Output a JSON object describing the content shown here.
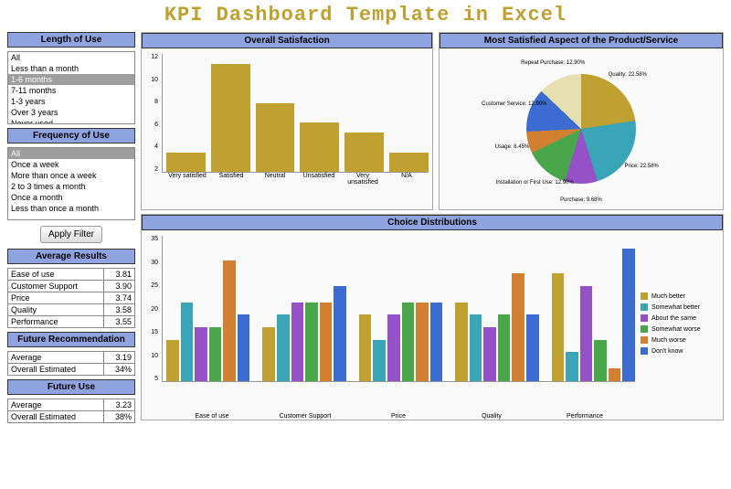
{
  "page_title": "KPI Dashboard Template in Excel",
  "filters": {
    "length_header": "Length of Use",
    "length_items": [
      "All",
      "Less than a month",
      "1-6 months",
      "7-11 months",
      "1-3 years",
      "Over 3 years",
      "Never used"
    ],
    "length_selected": "1-6 months",
    "freq_header": "Frequency of Use",
    "freq_items": [
      "All",
      "Once a week",
      "More than once a week",
      "2 to 3 times a month",
      "Once a month",
      "Less than once a month"
    ],
    "freq_selected": "All",
    "apply_label": "Apply Filter"
  },
  "avg_results": {
    "header": "Average Results",
    "rows": [
      {
        "label": "Ease of use",
        "value": "3.81"
      },
      {
        "label": "Customer Support",
        "value": "3.90"
      },
      {
        "label": "Price",
        "value": "3.74"
      },
      {
        "label": "Quality",
        "value": "3.58"
      },
      {
        "label": "Performance",
        "value": "3.55"
      }
    ]
  },
  "future_rec": {
    "header": "Future Recommendation",
    "rows": [
      {
        "label": "Average",
        "value": "3.19"
      },
      {
        "label": "Overall Estimated",
        "value": "34%"
      }
    ]
  },
  "future_use": {
    "header": "Future Use",
    "rows": [
      {
        "label": "Average",
        "value": "3.23"
      },
      {
        "label": "Overall Estimated",
        "value": "38%"
      }
    ]
  },
  "chart_data": [
    {
      "type": "bar",
      "title": "Overall Satisfaction",
      "categories": [
        "Very satisfied",
        "Satisfied",
        "Neutral",
        "Unsatisfied",
        "Very unsatisfied",
        "N/A"
      ],
      "values": [
        2,
        11,
        7,
        5,
        4,
        2
      ],
      "ylim": [
        0,
        12
      ],
      "yticks": [
        2,
        4,
        6,
        8,
        10,
        12
      ],
      "color": "#c0a030"
    },
    {
      "type": "pie",
      "title": "Most Satisfied Aspect of the Product/Service",
      "slices": [
        {
          "label": "Quality",
          "value": 22.58,
          "color": "#c0a030"
        },
        {
          "label": "Price",
          "value": 22.58,
          "color": "#39a5b7"
        },
        {
          "label": "Purchase",
          "value": 9.68,
          "color": "#9552c7"
        },
        {
          "label": "Installation or First Use",
          "value": 12.9,
          "color": "#4aa64a"
        },
        {
          "label": "Usage",
          "value": 6.45,
          "color": "#d08030"
        },
        {
          "label": "Customer Service",
          "value": 12.9,
          "color": "#3d6cd0"
        },
        {
          "label": "Repeat Purchase",
          "value": 12.9,
          "color": "#e6e0b0"
        }
      ]
    },
    {
      "type": "bar",
      "title": "Choice Distributions",
      "categories": [
        "Ease of use",
        "Customer Support",
        "Price",
        "Quality",
        "Performance"
      ],
      "series": [
        {
          "name": "Much better",
          "color": "#c0a030",
          "values": [
            10,
            13,
            16,
            19,
            26
          ]
        },
        {
          "name": "Somewhat better",
          "color": "#39a5b7",
          "values": [
            19,
            16,
            10,
            16,
            7
          ]
        },
        {
          "name": "About the same",
          "color": "#9552c7",
          "values": [
            13,
            19,
            16,
            13,
            23
          ]
        },
        {
          "name": "Somewhat worse",
          "color": "#4aa64a",
          "values": [
            13,
            19,
            19,
            16,
            10
          ]
        },
        {
          "name": "Much worse",
          "color": "#d08030",
          "values": [
            29,
            19,
            19,
            26,
            3
          ]
        },
        {
          "name": "Don't know",
          "color": "#3d6cd0",
          "values": [
            16,
            23,
            19,
            16,
            32
          ]
        }
      ],
      "ylim": [
        0,
        35
      ],
      "yticks": [
        5,
        10,
        15,
        20,
        25,
        30,
        35
      ]
    }
  ]
}
